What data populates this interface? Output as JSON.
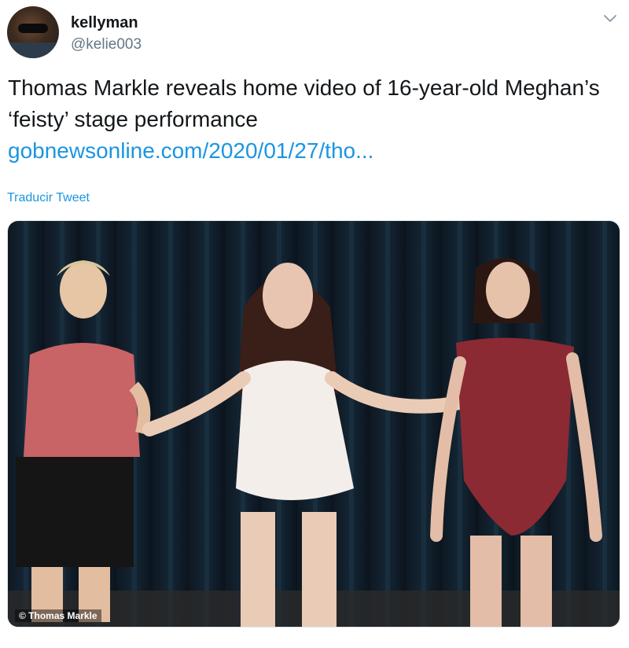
{
  "user": {
    "name": "kellyman",
    "handle": "@kelie003"
  },
  "tweet": {
    "text": "Thomas Markle reveals home video of 16-year-old Meghan’s ‘feisty’ stage performance",
    "link": "gobnewsonline.com/2020/01/27/tho...",
    "translate_label": "Traducir Tweet"
  },
  "media": {
    "credit": "© Thomas Markle"
  },
  "colors": {
    "link": "#1b95e0",
    "secondary_text": "#657786"
  },
  "icons": {
    "more": "chevron-down-icon"
  }
}
